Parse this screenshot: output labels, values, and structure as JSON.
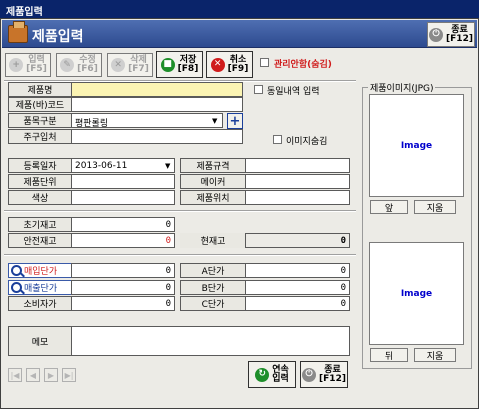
{
  "window": {
    "title": "제품입력"
  },
  "header": {
    "title": "제품입력"
  },
  "top_close": {
    "label1": "종료",
    "label2": "[F12]"
  },
  "toolbar": {
    "input": {
      "label1": "입력",
      "label2": "[F5]"
    },
    "edit": {
      "label1": "수정",
      "label2": "[F6]"
    },
    "delete": {
      "label1": "삭제",
      "label2": "[F7]"
    },
    "save": {
      "label1": "저장",
      "label2": "[F8]"
    },
    "cancel": {
      "label1": "취소",
      "label2": "[F9]"
    },
    "hide_mgmt_label": "관리안함(숨김)"
  },
  "form": {
    "product_name": {
      "label": "제품명",
      "value": ""
    },
    "barcode": {
      "label": "제품(바)코드",
      "value": ""
    },
    "category": {
      "label": "품목구분",
      "value": "평판롤링"
    },
    "supplier": {
      "label": "주구입처",
      "value": ""
    },
    "same_history_label": "동일내역 입력",
    "hide_image_label": "이미지숨김",
    "reg_date": {
      "label": "등록일자",
      "value": "2013-06-11"
    },
    "spec": {
      "label": "제품규격",
      "value": ""
    },
    "unit": {
      "label": "제품단위",
      "value": ""
    },
    "maker": {
      "label": "메이커",
      "value": ""
    },
    "color": {
      "label": "색상",
      "value": ""
    },
    "location": {
      "label": "제품위치",
      "value": ""
    },
    "initial_stock": {
      "label": "초기재고",
      "value": "0"
    },
    "safety_stock": {
      "label": "안전재고",
      "value": "0"
    },
    "current_stock": {
      "label": "현재고",
      "value": "0"
    },
    "purchase_price": {
      "label": "매입단가",
      "value": "0"
    },
    "sales_price": {
      "label": "매출단가",
      "value": "0"
    },
    "consumer_price": {
      "label": "소비자가",
      "value": "0"
    },
    "a_price": {
      "label": "A단가",
      "value": "0"
    },
    "b_price": {
      "label": "B단가",
      "value": "0"
    },
    "c_price": {
      "label": "C단가",
      "value": "0"
    },
    "memo": {
      "label": "메모",
      "value": ""
    }
  },
  "image_panel": {
    "title": "제품이미지(JPG)",
    "image1_text": "Image",
    "image2_text": "Image",
    "front_btn": "앞",
    "delete_btn1": "지움",
    "back_btn": "뒤",
    "delete_btn2": "지움"
  },
  "bottom": {
    "continuous": {
      "label1": "연속",
      "label2": "입력"
    },
    "close": {
      "label1": "종료",
      "label2": "[F12]"
    }
  },
  "nav": {
    "first": "|◀",
    "prev": "◀",
    "next": "▶",
    "last": "▶|"
  },
  "colors": {
    "accent": "#2d4a8f",
    "red_value": "#d01c1c",
    "yellow_field": "#fbf4b3"
  }
}
